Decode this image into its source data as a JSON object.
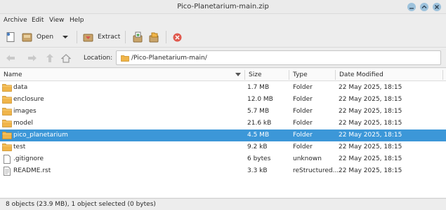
{
  "window": {
    "title": "Pico-Planetarium-main.zip"
  },
  "menu": [
    "Archive",
    "Edit",
    "View",
    "Help"
  ],
  "toolbar": {
    "open_label": "Open",
    "extract_label": "Extract"
  },
  "location": {
    "label": "Location:",
    "path": "/Pico-Planetarium-main/"
  },
  "columns": {
    "name": "Name",
    "size": "Size",
    "type": "Type",
    "modified": "Date Modified"
  },
  "files": [
    {
      "name": "data",
      "size": "1.7 MB",
      "type": "Folder",
      "modified": "22 May 2025, 18:15",
      "kind": "folder"
    },
    {
      "name": "enclosure",
      "size": "12.0 MB",
      "type": "Folder",
      "modified": "22 May 2025, 18:15",
      "kind": "folder"
    },
    {
      "name": "images",
      "size": "5.7 MB",
      "type": "Folder",
      "modified": "22 May 2025, 18:15",
      "kind": "folder"
    },
    {
      "name": "model",
      "size": "21.6 kB",
      "type": "Folder",
      "modified": "22 May 2025, 18:15",
      "kind": "folder"
    },
    {
      "name": "pico_planetarium",
      "size": "4.5 MB",
      "type": "Folder",
      "modified": "22 May 2025, 18:15",
      "kind": "folder",
      "selected": true
    },
    {
      "name": "test",
      "size": "9.2 kB",
      "type": "Folder",
      "modified": "22 May 2025, 18:15",
      "kind": "folder"
    },
    {
      "name": ".gitignore",
      "size": "6 bytes",
      "type": "unknown",
      "modified": "22 May 2025, 18:15",
      "kind": "file"
    },
    {
      "name": "README.rst",
      "size": "3.3 kB",
      "type": "reStructured...",
      "modified": "22 May 2025, 18:15",
      "kind": "text"
    }
  ],
  "status": {
    "text": "8 objects (23.9 MB), 1 object selected (0 bytes)"
  },
  "colors": {
    "selection": "#3c97d8",
    "folder": "#f0b54a",
    "window_button": "#9dc2dc"
  },
  "icons": [
    "new-archive-icon",
    "open-archive-icon",
    "dropdown-icon",
    "extract-icon",
    "add-files-icon",
    "add-folder-icon",
    "stop-icon",
    "back-icon",
    "forward-icon",
    "up-icon",
    "home-icon",
    "folder-icon",
    "sort-indicator-icon",
    "minimize-icon",
    "maximize-icon",
    "close-icon"
  ]
}
